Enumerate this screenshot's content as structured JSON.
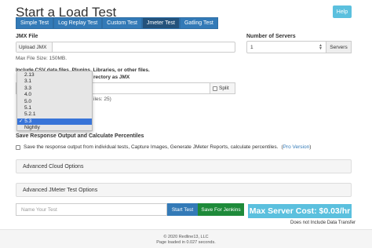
{
  "page": {
    "title": "Start a Load Test",
    "help_label": "Help"
  },
  "tabs": [
    {
      "label": "Simple Test"
    },
    {
      "label": "Log Replay Test"
    },
    {
      "label": "Custom Test"
    },
    {
      "label": "Jmeter Test",
      "active": true
    },
    {
      "label": "Gatling Test"
    }
  ],
  "jmx": {
    "label": "JMX File",
    "upload_label": "Upload JMX",
    "max_size": "Max File Size: 150MB."
  },
  "servers": {
    "label": "Number of Servers",
    "value": "1",
    "addon": "Servers"
  },
  "extra_files": {
    "label_start": "Include CSV data files, Plugins, Libraries, or other files.",
    "label_end": "rectory as JMX",
    "split_label": "Split",
    "files_note": "iles: 25)"
  },
  "version_dropdown": {
    "options": [
      "2.13",
      "3.1",
      "3.3",
      "4.0",
      "5.0",
      "5.1",
      "5.2.1",
      "5.3",
      "Nightly"
    ],
    "selected": "5.3"
  },
  "response": {
    "heading": "Save Response Output and Calculate Percentiles",
    "checkbox_label": "Save the response output from individual tests, Capture Images, Generate JMeter Reports, calculate percentiles.",
    "pro_link": "Pro Version"
  },
  "panels": {
    "cloud": "Advanced Cloud Options",
    "jmeter": "Advanced JMeter Test Options"
  },
  "actions": {
    "name_placeholder": "Name Your Test",
    "start": "Start Test",
    "jenkins": "Save For Jenkins",
    "cost": "Max Server Cost: $0.03/hr",
    "cost_note": "Does not Include Data Transfer"
  },
  "footer": {
    "copyright": "© 2020 Redline13, LLC",
    "load_time": "Page loaded in 0.027 seconds."
  }
}
